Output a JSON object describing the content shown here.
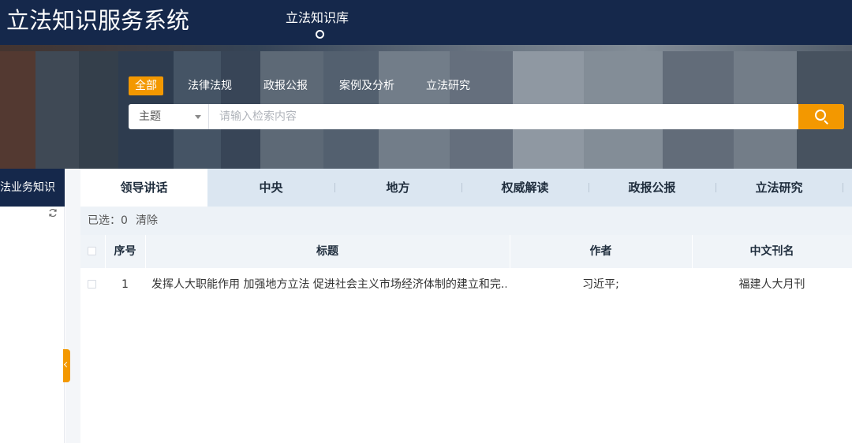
{
  "header": {
    "app_title": "立法知识服务系统",
    "nav_item": "立法知识库"
  },
  "search": {
    "categories": [
      "全部",
      "法律法规",
      "政报公报",
      "案例及分析",
      "立法研究"
    ],
    "active_category": "全部",
    "select_value": "主题",
    "placeholder": "请输入检索内容"
  },
  "sidebar": {
    "title": "立法业务知识"
  },
  "tabs": [
    "领导讲话",
    "中央",
    "地方",
    "权威解读",
    "政报公报",
    "立法研究"
  ],
  "active_tab": "领导讲话",
  "selection": {
    "count_label": "已选：0",
    "clear_label": "清除"
  },
  "table": {
    "columns": [
      "序号",
      "标题",
      "作者",
      "中文刊名"
    ],
    "rows": [
      [
        "1",
        "发挥人大职能作用 加强地方立法 促进社会主义市场经济体制的建立和完...",
        "习近平;",
        "福建人大月刊"
      ]
    ]
  },
  "colors": {
    "header_bg": "#15284b",
    "accent": "#f39800",
    "tab_bar": "#dbe6f1"
  }
}
